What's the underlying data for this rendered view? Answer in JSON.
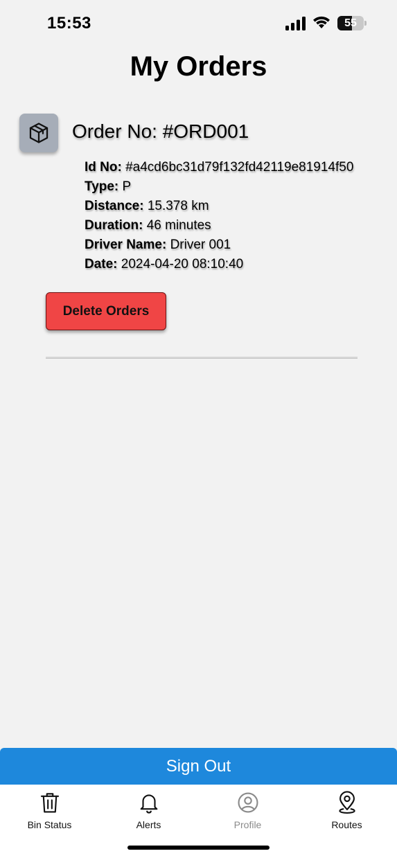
{
  "status_bar": {
    "time": "15:53",
    "battery_level": "55",
    "battery_fraction": 0.55
  },
  "page": {
    "title": "My Orders"
  },
  "order": {
    "icon": "package-box-icon",
    "title": "Order No: #ORD001",
    "details": [
      {
        "label": "Id No:",
        "value": "#a4cd6bc31d79f132fd42119e81914f50"
      },
      {
        "label": "Type:",
        "value": "P"
      },
      {
        "label": "Distance:",
        "value": " 15.378 km"
      },
      {
        "label": "Duration:",
        "value": "46 minutes"
      },
      {
        "label": "Driver Name:",
        "value": "Driver 001"
      },
      {
        "label": "Date:",
        "value": " 2024-04-20 08:10:40"
      }
    ],
    "delete_label": "Delete Orders"
  },
  "signout_label": "Sign Out",
  "tabs": [
    {
      "label": "Bin Status",
      "icon": "trash-bin-icon",
      "active": true
    },
    {
      "label": "Alerts",
      "icon": "bell-icon",
      "active": true
    },
    {
      "label": "Profile",
      "icon": "user-circle-icon",
      "active": false
    },
    {
      "label": "Routes",
      "icon": "map-pin-icon",
      "active": true
    }
  ],
  "colors": {
    "background": "#f2f2f2",
    "delete_button": "#f04545",
    "signout_button": "#1e88dc",
    "icon_box": "#a6adb8",
    "inactive_tab": "#8a8a8a"
  }
}
